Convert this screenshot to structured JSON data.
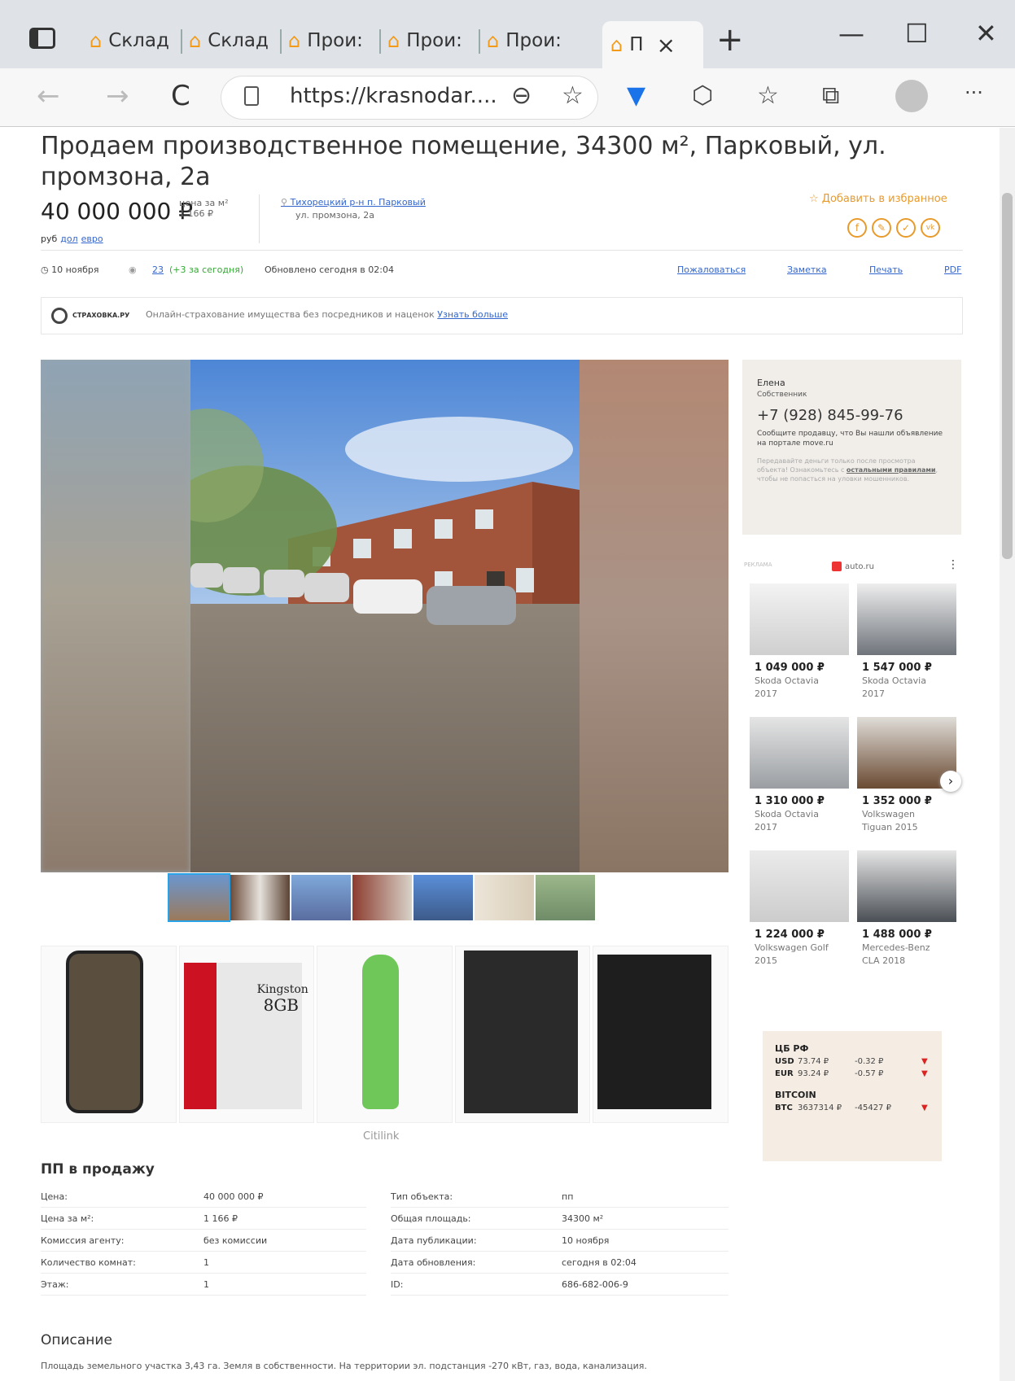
{
  "browser": {
    "tabs": [
      {
        "label": "Склад"
      },
      {
        "label": "Склад"
      },
      {
        "label": "Прои:"
      },
      {
        "label": "Прои:"
      },
      {
        "label": "Прои:"
      },
      {
        "label": "П"
      }
    ],
    "close_glyph": "×",
    "new_tab": "+",
    "minimize": "—",
    "maximize": "☐",
    "close": "✕",
    "back": "←",
    "forward": "→",
    "reload": "C",
    "url": "https://krasnodar....",
    "zoom": "⊖",
    "more": "···"
  },
  "listing": {
    "title": "Продаем производственное помещение, 34300 м², Парковый, ул. промзона, 2а",
    "price": "40 000 000 ₽",
    "price_per_m_label": "цена за м²",
    "price_per_m": "1 166 ₽",
    "currency_rub": "руб",
    "currency_usd": "дол",
    "currency_eur": "евро",
    "district": "Тихорецкий р-н",
    "village": "п. Парковый",
    "street": "ул. промзона, 2а",
    "favorite": "☆ Добавить в избранное",
    "social": [
      "f",
      "✎",
      "✓",
      "vk"
    ],
    "date": "◷ 10 ноября",
    "views": "23",
    "views_today": "(+3 за сегодня)",
    "updated": "Обновлено сегодня в 02:04",
    "complain": "Пожаловаться",
    "note": "Заметка",
    "print": "Печать",
    "pdf": "PDF"
  },
  "insurance": {
    "brand": "СТРАХОВКА.РУ",
    "text": "Онлайн-страхование имущества без посредников и наценок",
    "link": "Узнать больше"
  },
  "seller": {
    "name": "Елена",
    "role": "Собственник",
    "phone": "+7 (928) 845-99-76",
    "message": "Сообщите продавцу, что Вы нашли объявление на портале move.ru",
    "warning_pre": "Передавайте деньги только после просмотра объекта! Ознакомьтесь с",
    "warning_link": "остальными правилами",
    "warning_post": ", чтобы не попасться на уловки мошенников."
  },
  "auto_ad": {
    "label": "РЕКЛАМА",
    "brand": "auto.ru",
    "cars": [
      {
        "price": "1 049 000 ₽",
        "name": "Skoda Octavia",
        "year": "2017"
      },
      {
        "price": "1 547 000 ₽",
        "name": "Skoda Octavia",
        "year": "2017"
      },
      {
        "price": "1 310 000 ₽",
        "name": "Skoda Octavia",
        "year": "2017"
      },
      {
        "price": "1 352 000 ₽",
        "name": "Volkswagen",
        "year": "Tiguan 2015"
      },
      {
        "price": "1 224 000 ₽",
        "name": "Volkswagen Golf",
        "year": "2015"
      },
      {
        "price": "1 488 000 ₽",
        "name": "Mercedes-Benz",
        "year": "CLA 2018"
      }
    ]
  },
  "rates": {
    "cb_title": "ЦБ РФ",
    "usd": {
      "code": "USD",
      "value": "73.74 ₽",
      "change": "-0.32 ₽"
    },
    "eur": {
      "code": "EUR",
      "value": "93.24 ₽",
      "change": "-0.57 ₽"
    },
    "btc_title": "BITCOIN",
    "btc": {
      "code": "BTC",
      "value": "3637314 ₽",
      "change": "-45427 ₽"
    },
    "down": "▼"
  },
  "ads": {
    "vendor": "Citilink",
    "kingston": "Kingston",
    "gb": "8GB"
  },
  "specs": {
    "title": "ПП в продажу",
    "left": [
      {
        "k": "Цена:",
        "v": "40 000 000 ₽"
      },
      {
        "k": "Цена за м²:",
        "v": "1 166 ₽"
      },
      {
        "k": "Комиссия агенту:",
        "v": "без комиссии"
      },
      {
        "k": "Количество комнат:",
        "v": "1"
      },
      {
        "k": "Этаж:",
        "v": "1"
      }
    ],
    "right": [
      {
        "k": "Тип объекта:",
        "v": "пп"
      },
      {
        "k": "Общая площадь:",
        "v": "34300 м²"
      },
      {
        "k": "Дата публикации:",
        "v": "10 ноября"
      },
      {
        "k": "Дата обновления:",
        "v": "сегодня в 02:04"
      },
      {
        "k": "ID:",
        "v": "686-682-006-9"
      }
    ]
  },
  "description": {
    "title": "Описание",
    "text": "Площадь земельного участка 3,43 га. Земля в собственности. На территории эл. подстанция -270 кВт, газ, вода, канализация."
  }
}
